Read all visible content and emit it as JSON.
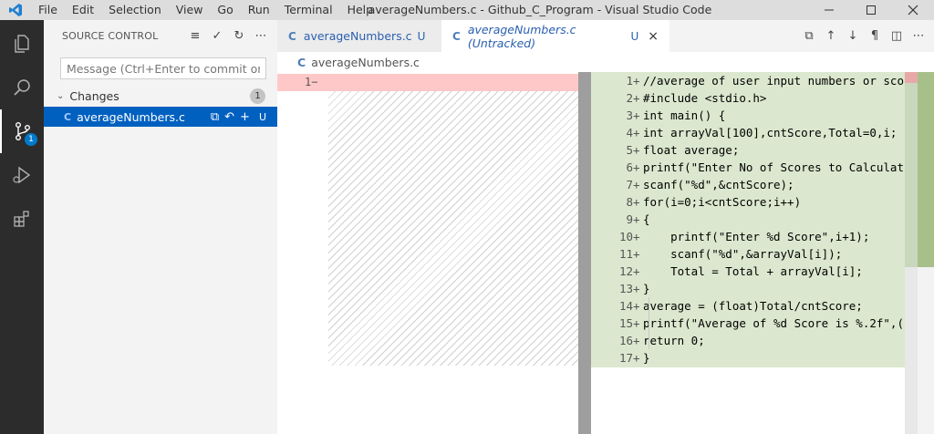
{
  "titlebar": {
    "menu": [
      "File",
      "Edit",
      "Selection",
      "View",
      "Go",
      "Run",
      "Terminal",
      "Help"
    ],
    "window_title": "averageNumbers.c - Github_C_Program - Visual Studio Code"
  },
  "activity_bar": {
    "items": [
      "explorer-icon",
      "search-icon",
      "source-control-icon",
      "run-debug-icon",
      "extensions-icon"
    ],
    "source_control_badge": "1"
  },
  "sidebar": {
    "title": "SOURCE CONTROL",
    "message_placeholder": "Message (Ctrl+Enter to commit on '...",
    "changes_label": "Changes",
    "changes_count": "1",
    "file": {
      "icon": "C",
      "name": "averageNumbers.c",
      "status": "U"
    }
  },
  "tabs": [
    {
      "icon": "C",
      "label": "averageNumbers.c",
      "status": "U"
    },
    {
      "icon": "C",
      "label": "averageNumbers.c (Untracked)",
      "status": "U",
      "close": "×"
    }
  ],
  "breadcrumb": {
    "icon": "C",
    "file": "averageNumbers.c"
  },
  "diff": {
    "left_line_number": "1",
    "left_marker": "−",
    "right_lines": [
      {
        "n": "1",
        "code": "//average of user input numbers or sco"
      },
      {
        "n": "2",
        "code": "#include <stdio.h>"
      },
      {
        "n": "3",
        "code": "int main() {"
      },
      {
        "n": "4",
        "code": "int arrayVal[100],cntScore,Total=0,i;"
      },
      {
        "n": "5",
        "code": "float average;"
      },
      {
        "n": "6",
        "code": "printf(\"Enter No of Scores to Calculat"
      },
      {
        "n": "7",
        "code": "scanf(\"%d\",&cntScore);"
      },
      {
        "n": "8",
        "code": "for(i=0;i<cntScore;i++)"
      },
      {
        "n": "9",
        "code": "{"
      },
      {
        "n": "10",
        "code": "    printf(\"Enter %d Score\",i+1);"
      },
      {
        "n": "11",
        "code": "    scanf(\"%d\",&arrayVal[i]);"
      },
      {
        "n": "12",
        "code": "    Total = Total + arrayVal[i];"
      },
      {
        "n": "13",
        "code": "}"
      },
      {
        "n": "14",
        "code": "average = (float)Total/cntScore;"
      },
      {
        "n": "15",
        "code": "printf(\"Average of %d Score is %.2f\",("
      },
      {
        "n": "16",
        "code": "return 0;"
      },
      {
        "n": "17",
        "code": "}"
      }
    ],
    "added_marker": "+"
  }
}
